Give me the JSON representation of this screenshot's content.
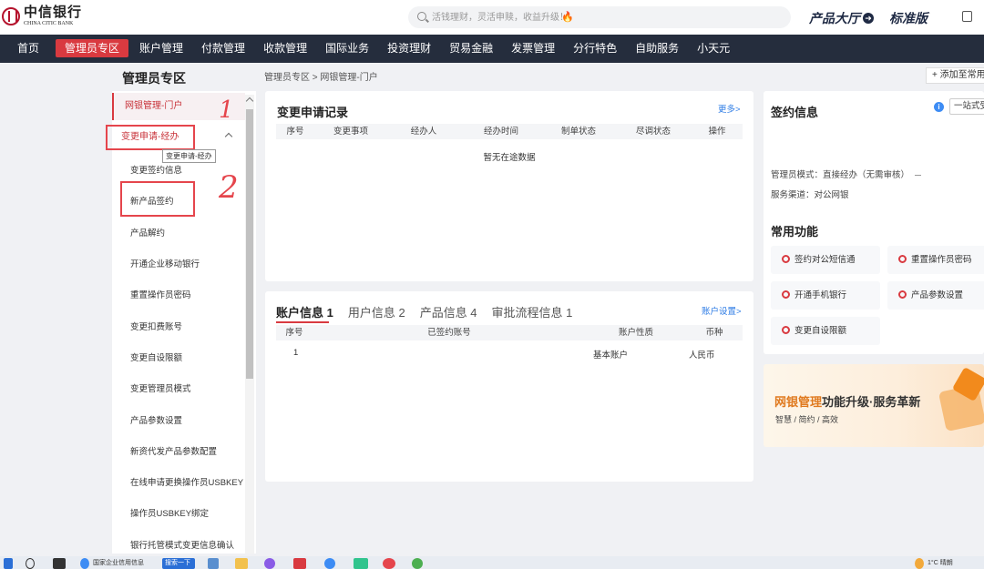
{
  "header": {
    "logo_cn": "中信银行",
    "logo_en": "CHINA CITIC BANK",
    "search_placeholder": "活钱理财，灵活申赎，收益升级！",
    "product_hall": "产品大厅",
    "standard_edition": "标准版"
  },
  "nav": {
    "items": [
      "首页",
      "管理员专区",
      "账户管理",
      "付款管理",
      "收款管理",
      "国际业务",
      "投资理财",
      "贸易金融",
      "发票管理",
      "分行特色",
      "自助服务",
      "小天元"
    ],
    "active_index": 1
  },
  "breadcrumb": "管理员专区 > 网银管理-门户",
  "add_shortcut": "添加至常用",
  "sidebar": {
    "title": "管理员专区",
    "portal": "网银管理-门户",
    "group": "变更申请-经办",
    "tooltip": "变更申请-经办",
    "items": [
      "变更签约信息",
      "新产品签约",
      "产品解约",
      "开通企业移动银行",
      "重置操作员密码",
      "变更扣费账号",
      "变更自设限额",
      "变更管理员模式",
      "产品参数设置",
      "新资代发产品参数配置",
      "在线申请更换操作员USBKEY",
      "操作员USBKEY绑定",
      "银行托管模式变更信息确认"
    ]
  },
  "annotations": {
    "mark1": "1",
    "mark2": "2"
  },
  "change_records": {
    "title": "变更申请记录",
    "more": "更多>",
    "columns": [
      "序号",
      "变更事项",
      "经办人",
      "经办时间",
      "制单状态",
      "尽调状态",
      "操作"
    ],
    "empty": "暂无在途数据"
  },
  "accounts": {
    "tabs": [
      "账户信息 1",
      "用户信息 2",
      "产品信息 4",
      "审批流程信息 1"
    ],
    "settings": "账户设置>",
    "columns": [
      "序号",
      "已签约账号",
      "账户性质",
      "币种"
    ],
    "rows": [
      {
        "no": "1",
        "account": "",
        "type": "基本账户",
        "currency": "人民币"
      }
    ]
  },
  "sign_info": {
    "title": "签约信息",
    "select": "一站式受理",
    "admin_mode": "管理员模式：直接经办（无需审核）",
    "channel": "服务渠道：对公网银"
  },
  "functions": {
    "title": "常用功能",
    "items": [
      "签约对公短信通",
      "重置操作员密码",
      "开通手机银行",
      "产品参数设置",
      "变更自设限额"
    ]
  },
  "banner": {
    "title_highlight": "网银管理",
    "title_rest": "功能升级·服务革新",
    "subtitle": "智慧 / 简约 / 高效"
  },
  "taskbar": {
    "app_label": "国家企业信用信息",
    "search_label": "搜索一下",
    "weather": "1°C 晴朗"
  }
}
